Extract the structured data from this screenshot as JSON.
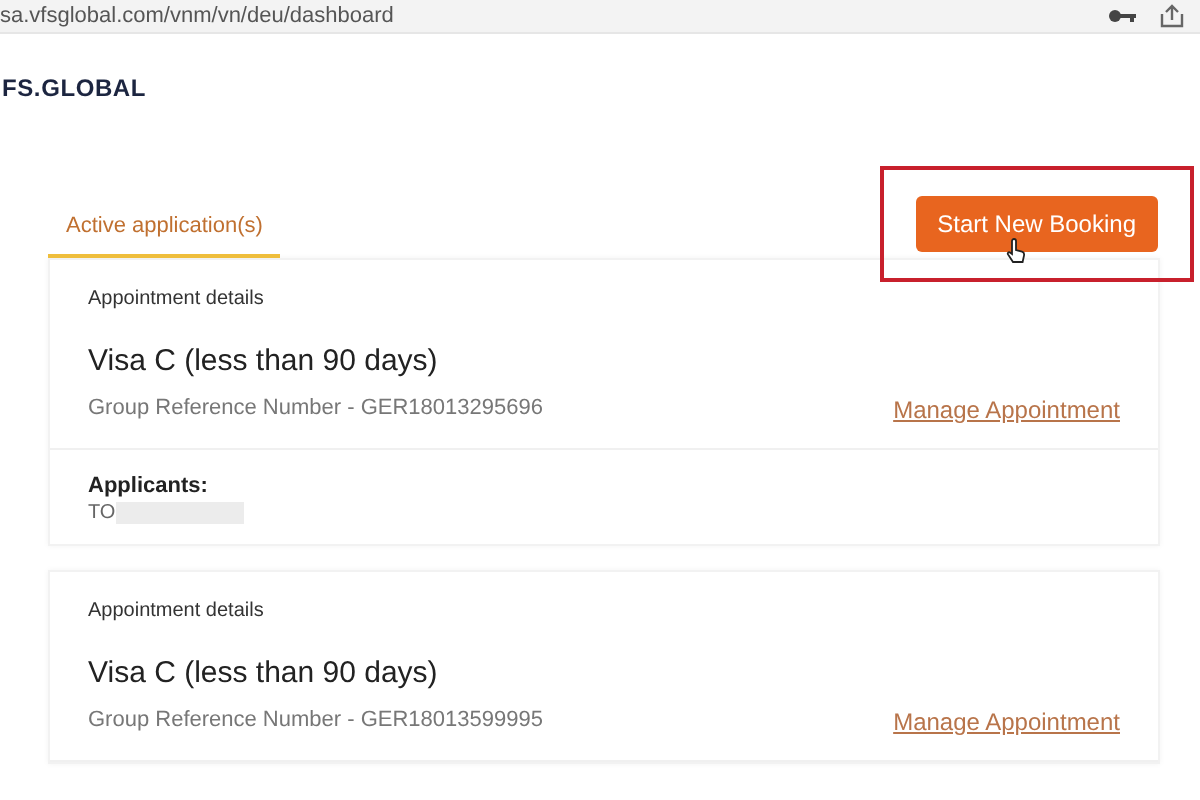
{
  "browser": {
    "url": "sa.vfsglobal.com/vnm/vn/deu/dashboard"
  },
  "logo": "FS.GLOBAL",
  "tabs": [
    {
      "label": "Active application(s)",
      "selected": true
    }
  ],
  "start_button": {
    "label": "Start New Booking",
    "highlighted": true
  },
  "appointments": [
    {
      "heading": "Appointment details",
      "visa_type": "Visa C (less than 90 days)",
      "reference": "Group Reference Number - GER18013295696",
      "manage_link": "Manage Appointment",
      "applicants_label": "Applicants:",
      "applicant": "TO",
      "redacted": true
    },
    {
      "heading": "Appointment details",
      "visa_type": "Visa C (less than 90 days)",
      "reference": "Group Reference Number - GER18013599995",
      "manage_link": "Manage Appointment"
    }
  ]
}
